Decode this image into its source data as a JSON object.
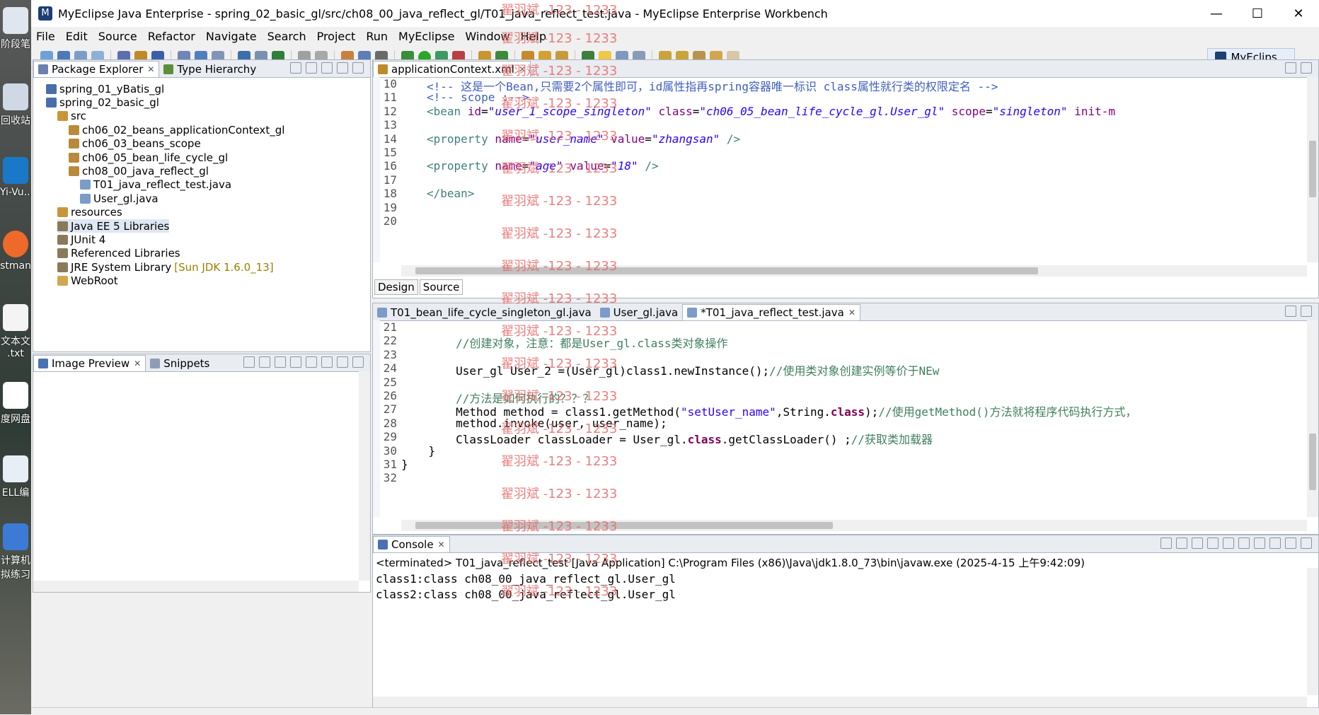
{
  "window": {
    "title": "MyEclipse Java Enterprise - spring_02_basic_gl/src/ch08_00_java_reflect_gl/T01_java_reflect_test.java - MyEclipse Enterprise Workbench",
    "minimize": "—",
    "maximize": "☐",
    "close": "✕"
  },
  "desktop": {
    "items": [
      "阶段笔",
      "回收站",
      "Yi-Vu...",
      "stman",
      "文本文\n.txt",
      "度网盘",
      "ELL编",
      "计算机\n拟练习"
    ]
  },
  "menu": [
    "File",
    "Edit",
    "Source",
    "Refactor",
    "Navigate",
    "Search",
    "Project",
    "Run",
    "MyEclipse",
    "Window",
    "Help"
  ],
  "perspective": {
    "label": "MyEclips..."
  },
  "explorer": {
    "tabs": [
      "Package Explorer",
      "Type Hierarchy"
    ],
    "tree": [
      {
        "label": "spring_01_yBatis_gl",
        "icon": "project-icon",
        "depth": 0
      },
      {
        "label": "spring_02_basic_gl",
        "icon": "project-icon",
        "depth": 0
      },
      {
        "label": "src",
        "icon": "source-folder-icon",
        "depth": 1
      },
      {
        "label": "ch06_02_beans_applicationContext_gl",
        "icon": "package-icon",
        "depth": 2
      },
      {
        "label": "ch06_03_beans_scope",
        "icon": "package-icon",
        "depth": 2
      },
      {
        "label": "ch06_05_bean_life_cycle_gl",
        "icon": "package-icon",
        "depth": 2
      },
      {
        "label": "ch08_00_java_reflect_gl",
        "icon": "package-icon",
        "depth": 2
      },
      {
        "label": "T01_java_reflect_test.java",
        "icon": "java-file-icon",
        "depth": 3
      },
      {
        "label": "User_gl.java",
        "icon": "java-file-icon",
        "depth": 3
      },
      {
        "label": "resources",
        "icon": "source-folder-icon",
        "depth": 1
      },
      {
        "label": "Java EE 5 Libraries",
        "icon": "library-icon",
        "depth": 1,
        "selected": true
      },
      {
        "label": "JUnit 4",
        "icon": "library-icon",
        "depth": 1
      },
      {
        "label": "Referenced Libraries",
        "icon": "library-icon",
        "depth": 1
      },
      {
        "label": "JRE System Library",
        "icon": "library-icon",
        "depth": 1,
        "suffix": "[Sun JDK 1.6.0_13]"
      },
      {
        "label": "WebRoot",
        "icon": "folder-icon",
        "depth": 1
      }
    ]
  },
  "preview": {
    "tabs": [
      "Image Preview",
      "Snippets"
    ]
  },
  "xml_editor": {
    "tab": "applicationContext.xml",
    "bottom_tabs": [
      "Design",
      "Source"
    ],
    "lines": [
      {
        "n": "10",
        "html": "<span class=\"cmt\">&lt;!-- 这是一个Bean,只需要2个属性即可，id属性指再spring容器唯一标识 class属性就行类的权限定名 --&gt;</span>"
      },
      {
        "n": "11",
        "html": "<span class=\"cmt\">&lt;!-- scope :--&gt;</span>"
      },
      {
        "n": "12",
        "html": "<span class=\"tag\">&lt;bean</span> <span class=\"attr\">id</span>=<span class=\"val\">\"user_1_scope_singleton\"</span> <span class=\"attr\">class</span>=<span class=\"val\">\"ch06_05_bean_life_cycle_gl.User_gl\"</span> <span class=\"attr\">scope</span>=<span class=\"val\">\"singleton\"</span> <span class=\"attr\">init-m</span>"
      },
      {
        "n": "13",
        "html": ""
      },
      {
        "n": "14",
        "html": "<span class=\"tag\">&lt;property</span> <span class=\"attr\">name</span>=<span class=\"val\">\"user_name\"</span> <span class=\"attr\">value</span>=<span class=\"val\">\"zhangsan\"</span> <span class=\"tag\">/&gt;</span>"
      },
      {
        "n": "15",
        "html": ""
      },
      {
        "n": "16",
        "html": "<span class=\"tag\">&lt;property</span> <span class=\"attr\">name</span>=<span class=\"val\">\"age\"</span> <span class=\"attr\">value</span>=<span class=\"val\">\"18\"</span> <span class=\"tag\">/&gt;</span>"
      },
      {
        "n": "17",
        "html": ""
      },
      {
        "n": "18",
        "html": "<span class=\"tag\">&lt;/bean&gt;</span>"
      },
      {
        "n": "19",
        "html": ""
      },
      {
        "n": "20",
        "html": ""
      }
    ]
  },
  "java_editor": {
    "tabs": [
      "T01_bean_life_cycle_singleton_gl.java",
      "User_gl.java",
      "*T01_java_reflect_test.java"
    ],
    "lines": [
      {
        "n": "21",
        "html": ""
      },
      {
        "n": "22",
        "html": "        <span class=\"jcmt\">//创建对象，注意：都是User_gl.class类对象操作</span>"
      },
      {
        "n": "23",
        "html": ""
      },
      {
        "n": "24",
        "html": "        User_gl User_2 =(User_gl)class1.newInstance();<span class=\"jcmt\">//使用类对象创建实例等价于NEw</span>"
      },
      {
        "n": "25",
        "html": ""
      },
      {
        "n": "26",
        "html": "        <span class=\"jcmt\">//方法是如何执行的？？？</span>"
      },
      {
        "n": "27",
        "html": "        Method method = class1.getMethod(<span class=\"str\">\"setUser_name\"</span>,String.<span class=\"kw\">class</span>);<span class=\"jcmt\">//使用getMethod()方法就将程序代码执行方式，</span>"
      },
      {
        "n": "28",
        "html": "        method.invoke(user, user_name);"
      },
      {
        "n": "29",
        "html": "        ClassLoader classLoader = User_gl.<span class=\"kw\">class</span>.getClassLoader() ;<span class=\"jcmt\">//获取类加载器</span>"
      },
      {
        "n": "30",
        "html": "    }"
      },
      {
        "n": "31",
        "html": "}"
      },
      {
        "n": "32",
        "html": ""
      }
    ]
  },
  "console": {
    "tab": "Console",
    "header": "<terminated> T01_java_reflect_test [Java Application] C:\\Program Files (x86)\\Java\\jdk1.8.0_73\\bin\\javaw.exe (2025-4-15 上午9:42:09)",
    "output": [
      "class1:class ch08_00_java_reflect_gl.User_gl",
      "class2:class ch08_00_java_reflect_gl.User_gl"
    ]
  },
  "watermark": "翟羽斌 -123 - 1233",
  "colors": {
    "accent": "#1d3f73",
    "selection": "#dfe7f3",
    "watermark": "#e46a6a"
  }
}
